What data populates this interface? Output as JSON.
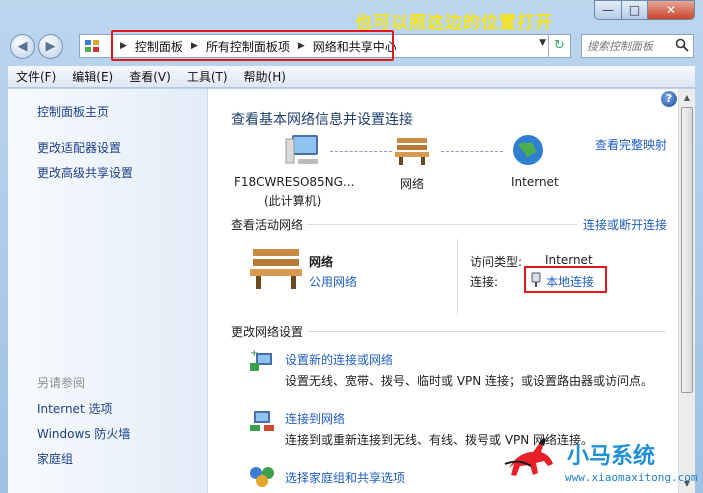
{
  "caption": "也可以照这边的位置打开",
  "window": {
    "min": "—",
    "max": "□",
    "close": "✕"
  },
  "nav": {
    "back": "◀",
    "forward": "▶",
    "dropdown": "▼",
    "refresh": "↻"
  },
  "breadcrumb": [
    "控制面板",
    "所有控制面板项",
    "网络和共享中心"
  ],
  "search": {
    "placeholder": "搜索控制面板"
  },
  "menu": [
    "文件(F)",
    "编辑(E)",
    "查看(V)",
    "工具(T)",
    "帮助(H)"
  ],
  "sidebar": {
    "home": "控制面板主页",
    "links": [
      "更改适配器设置",
      "更改高级共享设置"
    ],
    "see_also_title": "另请参阅",
    "see_also": [
      "Internet 选项",
      "Windows 防火墙",
      "家庭组"
    ]
  },
  "main": {
    "title": "查看基本网络信息并设置连接",
    "full_map": "查看完整映射",
    "map": {
      "computer": "F18CWRESO85NG...",
      "computer_note": "(此计算机)",
      "network": "网络",
      "internet": "Internet"
    },
    "active": {
      "title": "查看活动网络",
      "connect_link": "连接或断开连接",
      "network_name": "网络",
      "network_type": "公用网络",
      "access_label": "访问类型:",
      "access_value": "Internet",
      "connection_label": "连接:",
      "connection_value": "本地连接"
    },
    "change": {
      "title": "更改网络设置",
      "items": [
        {
          "title": "设置新的连接或网络",
          "desc": "设置无线、宽带、拨号、临时或 VPN 连接；或设置路由器或访问点。"
        },
        {
          "title": "连接到网络",
          "desc": "连接到或重新连接到无线、有线、拨号或 VPN 网络连接。"
        },
        {
          "title": "选择家庭组和共享选项",
          "desc": ""
        }
      ]
    }
  },
  "watermark": {
    "title": "小马系统",
    "url": "www.xiaomaxitong.com"
  }
}
